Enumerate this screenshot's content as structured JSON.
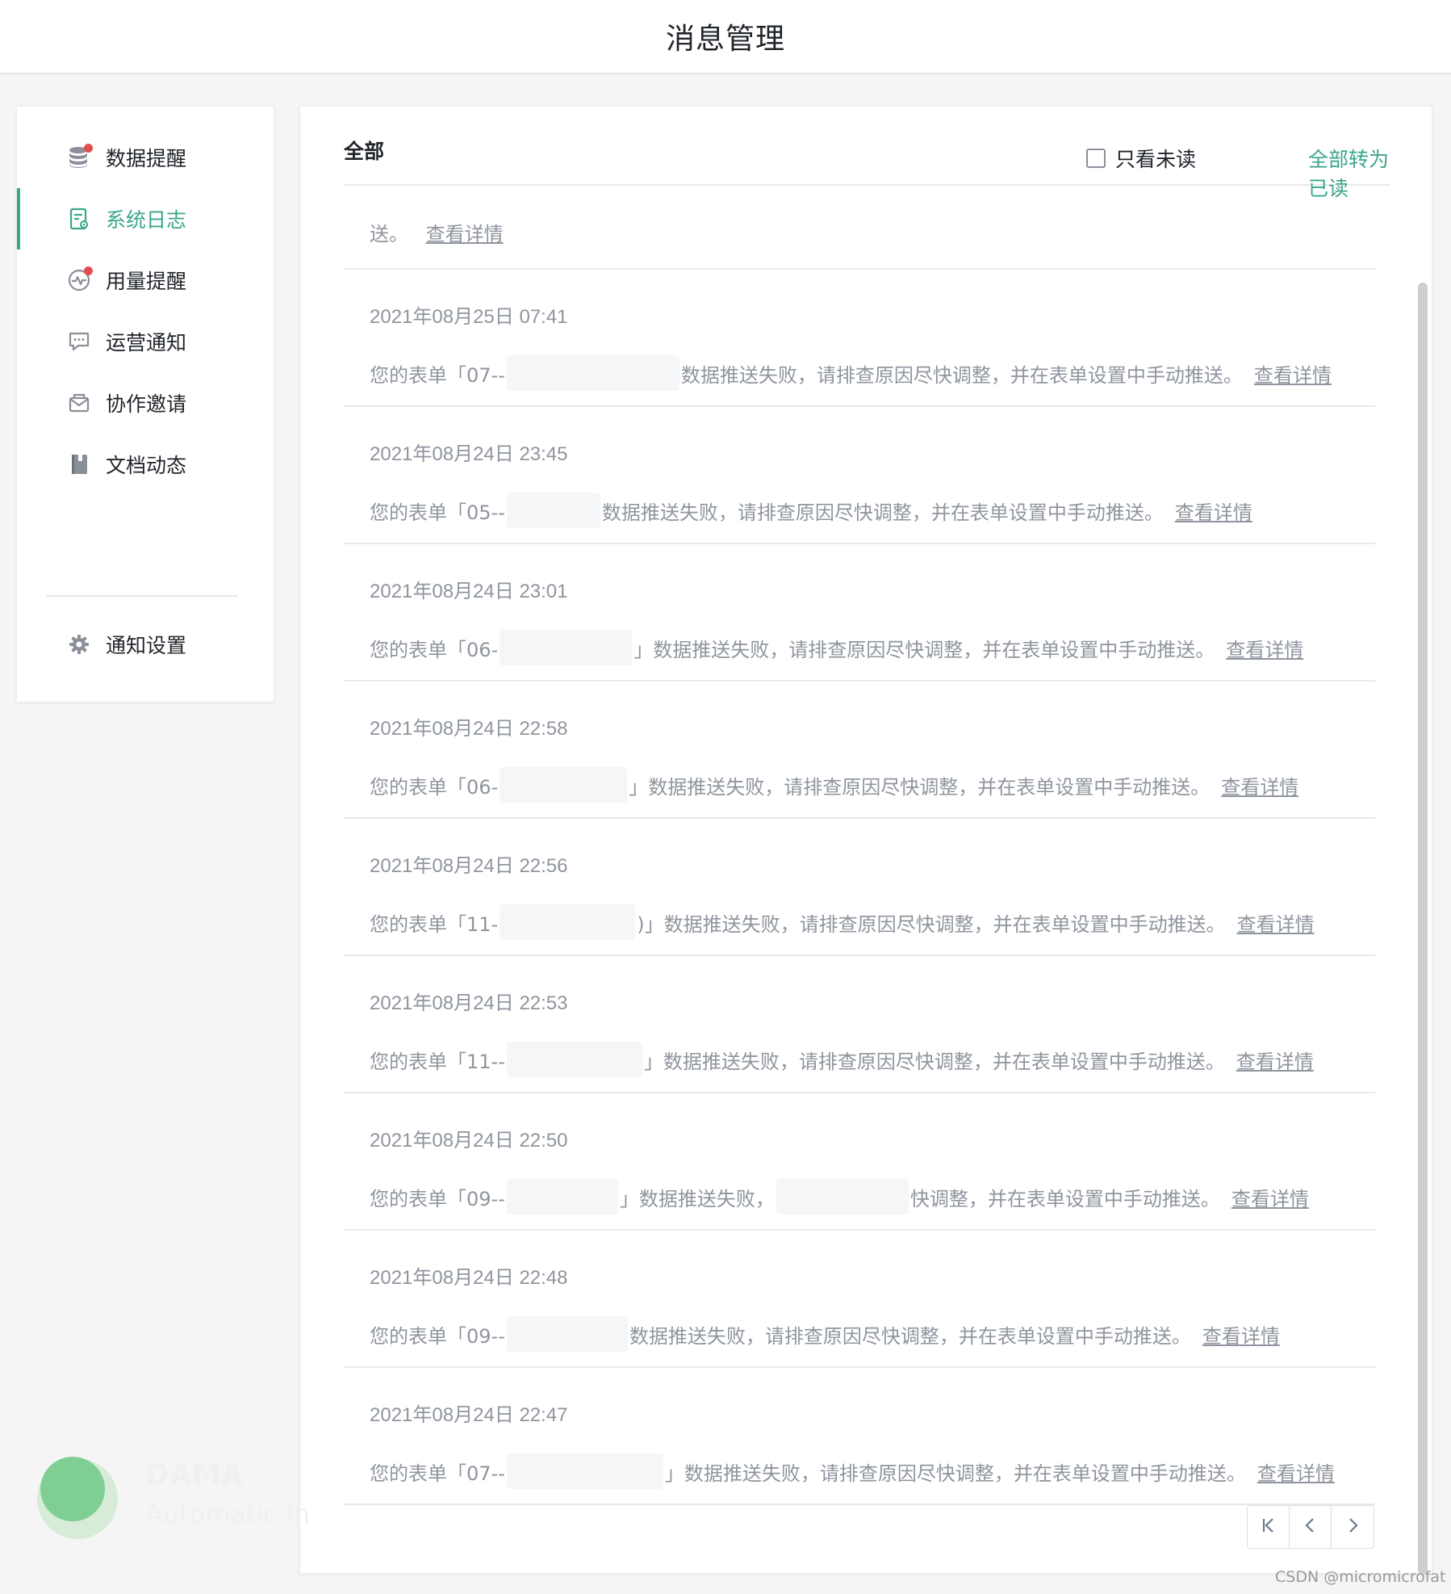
{
  "header": {
    "title": "消息管理"
  },
  "sidebar": {
    "items": [
      {
        "label": "数据提醒",
        "icon": "database-icon",
        "badge": true,
        "active": false
      },
      {
        "label": "系统日志",
        "icon": "system-log-icon",
        "badge": false,
        "active": true
      },
      {
        "label": "用量提醒",
        "icon": "usage-pulse-icon",
        "badge": true,
        "active": false
      },
      {
        "label": "运营通知",
        "icon": "chat-bubble-icon",
        "badge": false,
        "active": false
      },
      {
        "label": "协作邀请",
        "icon": "mail-invite-icon",
        "badge": false,
        "active": false
      },
      {
        "label": "文档动态",
        "icon": "book-icon",
        "badge": false,
        "active": false
      }
    ],
    "settings": {
      "label": "通知设置",
      "icon": "gear-icon"
    }
  },
  "main": {
    "tab": "全部",
    "unread_only_label": "只看未读",
    "unread_only_checked": false,
    "mark_all_read_label": "全部转为已读",
    "partial_item": {
      "line2_prefix": "送。",
      "link": "查看详情"
    },
    "messages": [
      {
        "time": "2021年08月25日 07:41",
        "prefix": "您的表单「07--",
        "suffix": "数据推送失败，请排查原因尽快调整，并在表单设置中手动推送。",
        "link": "查看详情"
      },
      {
        "time": "2021年08月24日 23:45",
        "prefix": "您的表单「05--",
        "suffix": "数据推送失败，请排查原因尽快调整，并在表单设置中手动推送。",
        "link": "查看详情"
      },
      {
        "time": "2021年08月24日 23:01",
        "prefix": "您的表单「06-",
        "suffix": "」数据推送失败，请排查原因尽快调整，并在表单设置中手动推送。",
        "link": "查看详情"
      },
      {
        "time": "2021年08月24日 22:58",
        "prefix": "您的表单「06-",
        "suffix": "」数据推送失败，请排查原因尽快调整，并在表单设置中手动推送。",
        "link": "查看详情"
      },
      {
        "time": "2021年08月24日 22:56",
        "prefix": "您的表单「11-",
        "suffix": ")」数据推送失败，请排查原因尽快调整，并在表单设置中手动推送。",
        "link": "查看详情"
      },
      {
        "time": "2021年08月24日 22:53",
        "prefix": "您的表单「11--",
        "suffix": "」数据推送失败，请排查原因尽快调整，并在表单设置中手动推送。",
        "link": "查看详情"
      },
      {
        "time": "2021年08月24日 22:50",
        "prefix": "您的表单「09--",
        "suffix": "」数据推送失败，",
        "suffix2": "快调整，并在表单设置中手动推送。",
        "link": "查看详情"
      },
      {
        "time": "2021年08月24日 22:48",
        "prefix": "您的表单「09--",
        "suffix": "数据推送失败，请排查原因尽快调整，并在表单设置中手动推送。",
        "link": "查看详情"
      },
      {
        "time": "2021年08月24日 22:47",
        "prefix": "您的表单「07--",
        "suffix": "」数据推送失败，请排查原因尽快调整，并在表单设置中手动推送。",
        "link": "查看详情"
      }
    ]
  },
  "pagination": {
    "first_icon": "first-page-icon",
    "prev_icon": "chevron-left-icon",
    "next_icon": "chevron-right-icon"
  },
  "watermark": {
    "line1": "DAMA",
    "line2": "Automatic In"
  },
  "credit": "CSDN @micromicrofat",
  "colors": {
    "accent": "#3aa68c",
    "badge": "#e34d4d",
    "muted_text": "#8f959e"
  }
}
